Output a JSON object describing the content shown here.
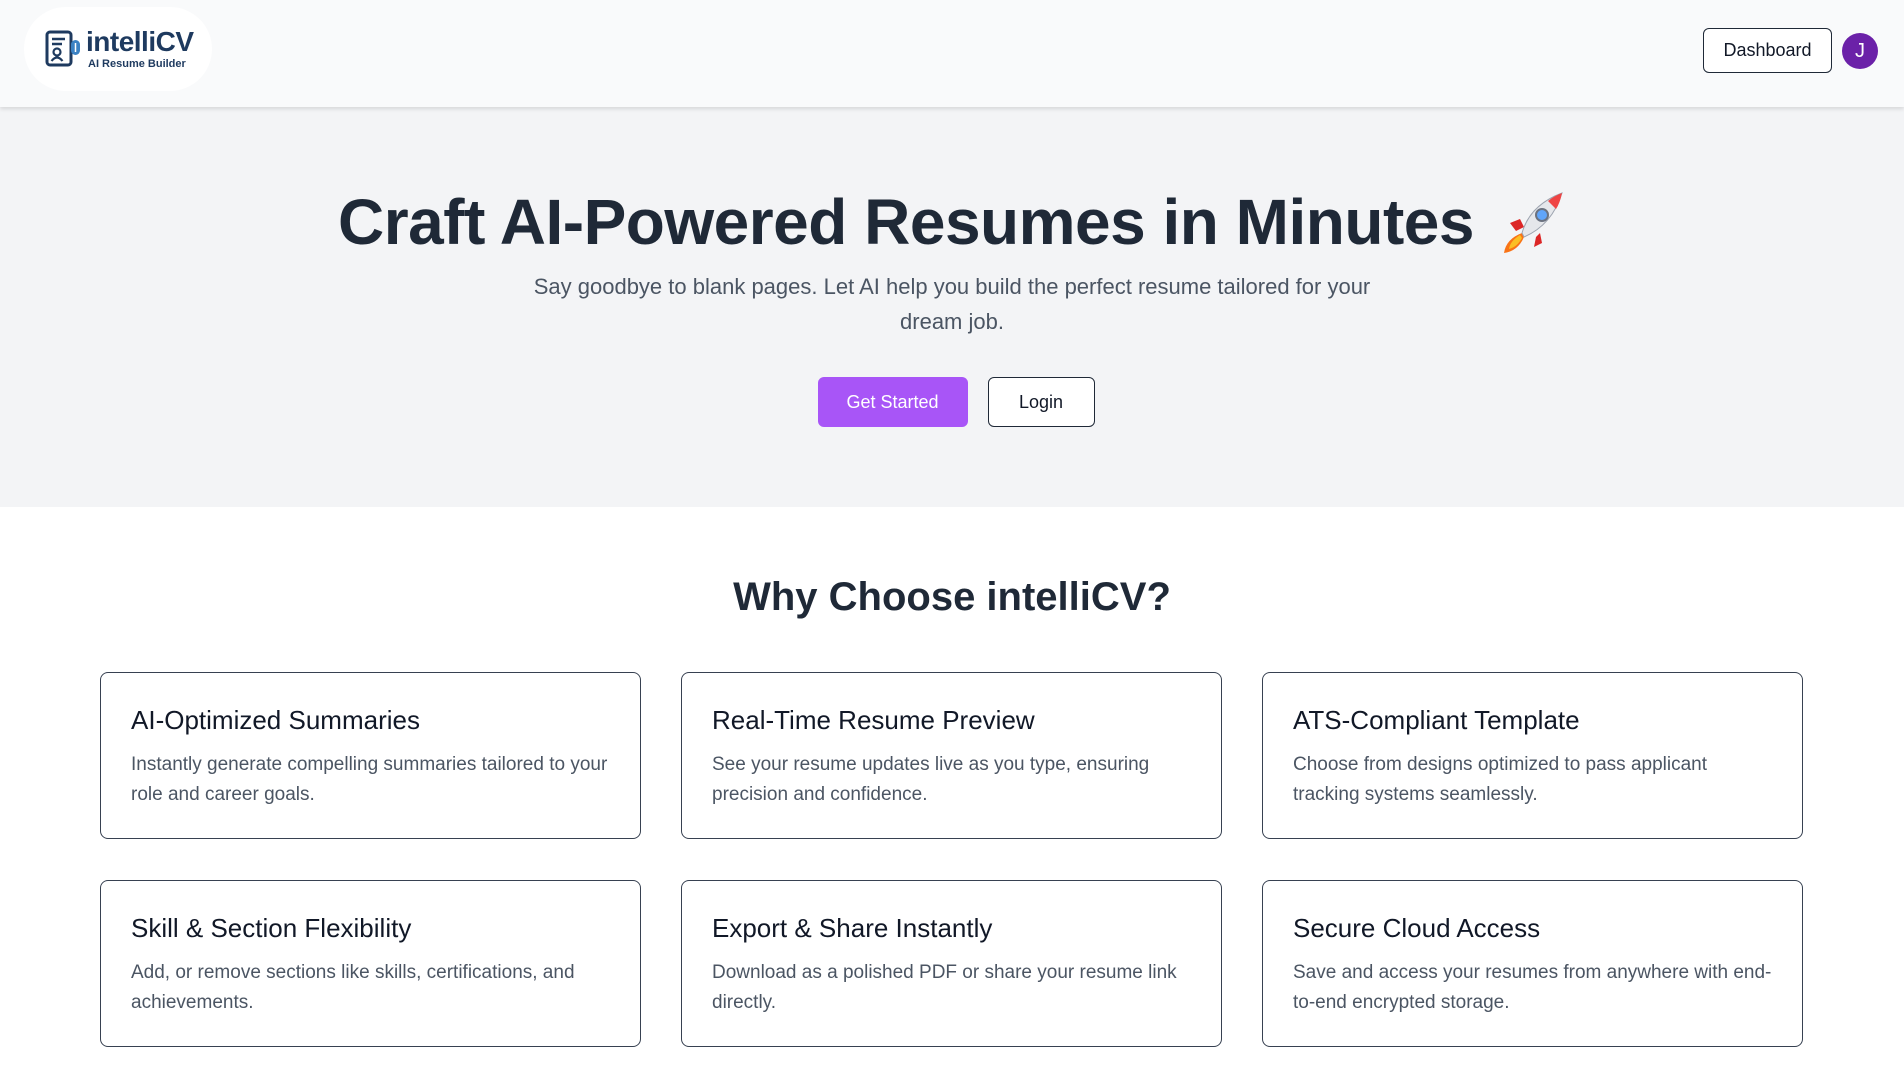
{
  "header": {
    "logo": {
      "name": "intelliCV",
      "tagline": "AI Resume Builder",
      "icon": "resume-document-icon"
    },
    "dashboard_label": "Dashboard",
    "avatar_initial": "J"
  },
  "hero": {
    "title": "Craft AI-Powered Resumes in Minutes",
    "title_icon": "rocket-icon",
    "subtitle": "Say goodbye to blank pages. Let AI help you build the perfect resume tailored for your dream job.",
    "primary_button": "Get Started",
    "secondary_button": "Login"
  },
  "features": {
    "title": "Why Choose intelliCV?",
    "items": [
      {
        "title": "AI-Optimized Summaries",
        "description": "Instantly generate compelling summaries tailored to your role and career goals."
      },
      {
        "title": "Real-Time Resume Preview",
        "description": "See your resume updates live as you type, ensuring precision and confidence."
      },
      {
        "title": "ATS-Compliant Template",
        "description": "Choose from designs optimized to pass applicant tracking systems seamlessly."
      },
      {
        "title": "Skill & Section Flexibility",
        "description": "Add, or remove sections like skills, certifications, and achievements."
      },
      {
        "title": "Export & Share Instantly",
        "description": "Download as a polished PDF or share your resume link directly."
      },
      {
        "title": "Secure Cloud Access",
        "description": "Save and access your resumes from anywhere with end-to-end encrypted storage."
      }
    ]
  },
  "colors": {
    "primary": "#a855f7",
    "avatar": "#6b21a8",
    "heading": "#1f2937",
    "brand": "#1e3a5f"
  }
}
